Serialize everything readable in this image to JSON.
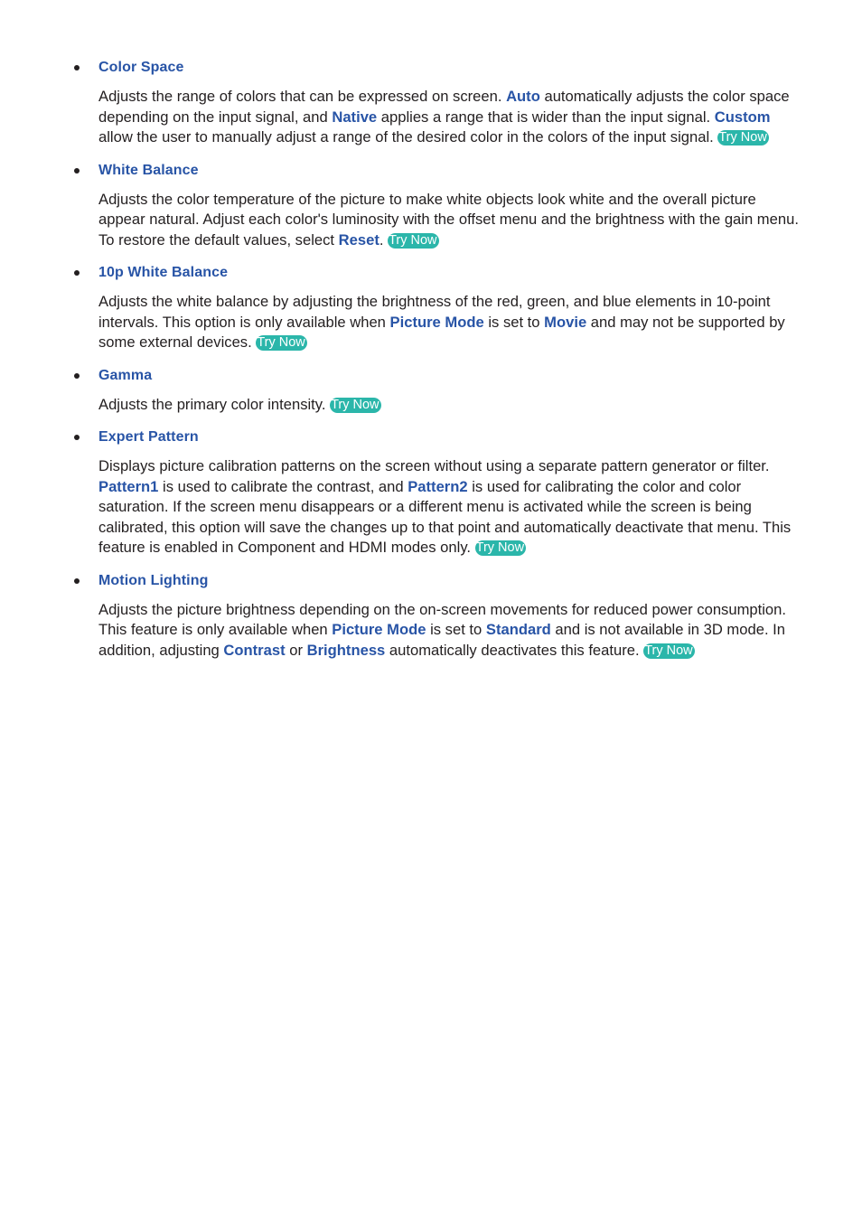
{
  "colors": {
    "text": "#231f20",
    "keyword": "#2854a6",
    "try_now_bg": "#2bb6aa",
    "try_now_text": "#ffffff"
  },
  "try_now_label": "Try Now",
  "items": [
    {
      "title": "Color Space",
      "segments": [
        {
          "t": "Adjusts the range of colors that can be expressed on screen. "
        },
        {
          "t": "Auto",
          "kw": true
        },
        {
          "t": " automatically adjusts the color space depending on the input signal, and "
        },
        {
          "t": "Native",
          "kw": true
        },
        {
          "t": " applies a range that is wider than the input signal. "
        },
        {
          "t": "Custom",
          "kw": true
        },
        {
          "t": " allow the user to manually adjust a range of the desired color in the colors of the input signal. "
        }
      ]
    },
    {
      "title": "White Balance",
      "segments": [
        {
          "t": "Adjusts the color temperature of the picture to make white objects look white and the overall picture appear natural. Adjust each color's luminosity with the offset menu and the brightness with the gain menu. To restore the default values, select "
        },
        {
          "t": "Reset",
          "kw": true
        },
        {
          "t": ". "
        }
      ]
    },
    {
      "title": "10p White Balance",
      "segments": [
        {
          "t": "Adjusts the white balance by adjusting the brightness of the red, green, and blue elements in 10-point intervals. This option is only available when "
        },
        {
          "t": "Picture Mode",
          "kw": true
        },
        {
          "t": " is set to "
        },
        {
          "t": "Movie",
          "kw": true
        },
        {
          "t": " and may not be supported by some external devices. "
        }
      ]
    },
    {
      "title": "Gamma",
      "segments": [
        {
          "t": "Adjusts the primary color intensity. "
        }
      ]
    },
    {
      "title": "Expert Pattern",
      "segments": [
        {
          "t": "Displays picture calibration patterns on the screen without using a separate pattern generator or filter. "
        },
        {
          "t": "Pattern1",
          "kw": true
        },
        {
          "t": " is used to calibrate the contrast, and "
        },
        {
          "t": "Pattern2",
          "kw": true
        },
        {
          "t": " is used for calibrating the color and color saturation. If the screen menu disappears or a different menu is activated while the screen is being calibrated, this option will save the changes up to that point and automatically deactivate that menu. This feature is enabled in Component and HDMI modes only. "
        }
      ]
    },
    {
      "title": "Motion Lighting",
      "segments": [
        {
          "t": "Adjusts the picture brightness depending on the on-screen movements for reduced power consumption. This feature is only available when "
        },
        {
          "t": "Picture Mode",
          "kw": true
        },
        {
          "t": " is set to "
        },
        {
          "t": "Standard",
          "kw": true
        },
        {
          "t": " and is not available in 3D mode. In addition, adjusting "
        },
        {
          "t": "Contrast",
          "kw": true
        },
        {
          "t": " or "
        },
        {
          "t": "Brightness",
          "kw": true
        },
        {
          "t": " automatically deactivates this feature. "
        }
      ]
    }
  ]
}
